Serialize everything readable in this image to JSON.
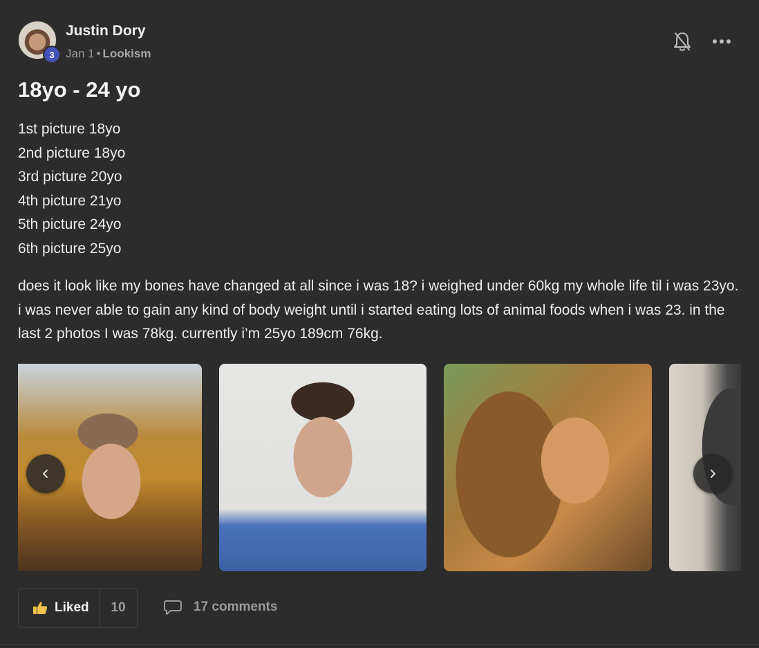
{
  "post": {
    "author": "Justin Dory",
    "level": "3",
    "date": "Jan 1",
    "separator": "•",
    "community": "Lookism",
    "title": "18yo - 24 yo",
    "lines": [
      "1st picture 18yo",
      "2nd picture 18yo",
      "3rd picture 20yo",
      "4th picture 21yo",
      "5th picture 24yo",
      "6th picture 25yo"
    ],
    "body": "does it look like my bones have changed at all since i was 18? i weighed under 60kg my whole life til i was 23yo. i was never able to gain any kind of body weight until i started eating lots of animal foods when i was 23. in the last 2 photos I was 78kg. currently i’m 25yo 189cm 76kg."
  },
  "actions": {
    "like_label": "Liked",
    "like_count": "10",
    "comments_label": "17 comments"
  },
  "gallery": {
    "photo_count": 6,
    "visible_photos": 4
  },
  "icons": {
    "notifications": "bell-off-icon",
    "more": "more-horizontal-icon",
    "prev": "chevron-left-icon",
    "next": "chevron-right-icon",
    "like": "thumbs-up-icon",
    "comment": "comment-icon"
  },
  "colors": {
    "background": "#2c2c2c",
    "level_badge": "#4451b8",
    "like_icon": "#f2c34a",
    "muted_text": "#9a9a9a"
  }
}
